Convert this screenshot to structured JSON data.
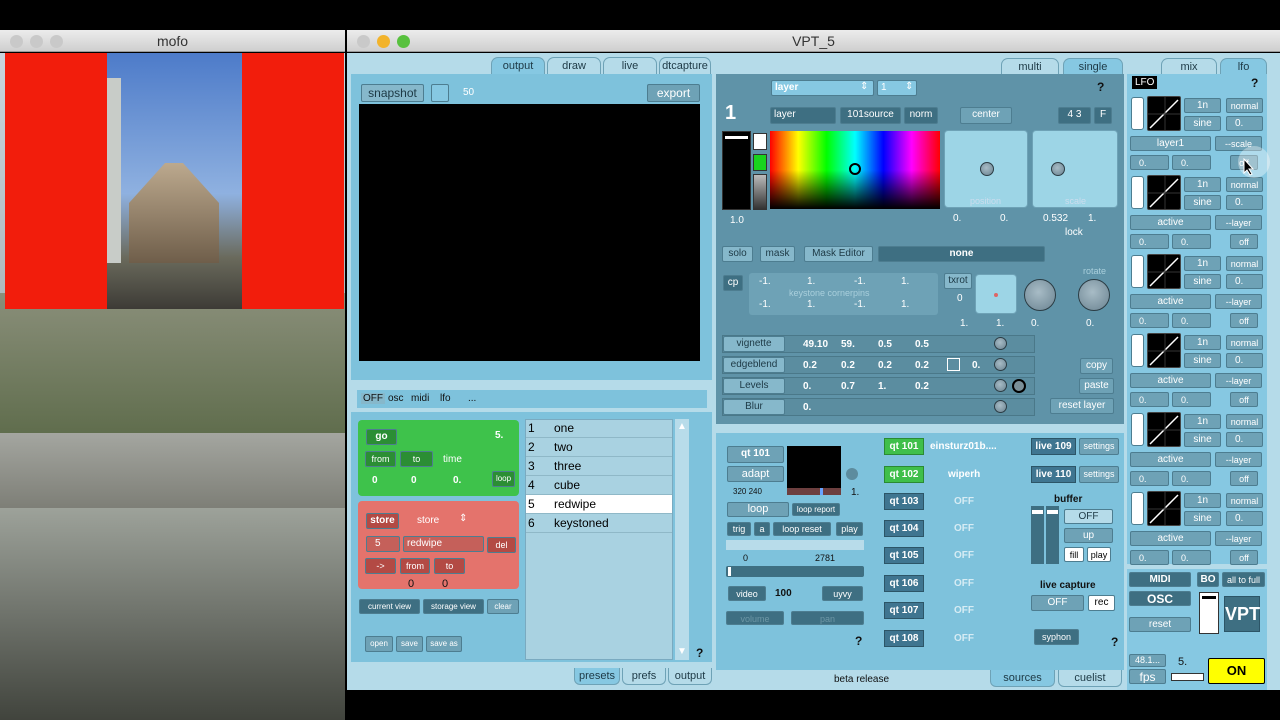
{
  "mofo": {
    "title": "mofo"
  },
  "vpt": {
    "title": "VPT_5"
  },
  "output_tabs": [
    "output",
    "draw",
    "live",
    "dtcapture"
  ],
  "snapshot": {
    "label": "snapshot",
    "value": "50",
    "export": "export"
  },
  "mode_tabs": [
    "multi",
    "single"
  ],
  "mixlfo_tabs": [
    "mix",
    "lfo"
  ],
  "protocols": {
    "off": "OFF",
    "osc": "osc",
    "midi": "midi",
    "lfo": "lfo",
    "more": "..."
  },
  "cue": {
    "go": "go",
    "num": "5.",
    "from": "from",
    "to": "to",
    "time": "time",
    "vals": [
      "0",
      "0",
      "0."
    ],
    "loop": "loop",
    "store": "store",
    "store_select": "store",
    "preset_num": "5",
    "preset_name": "redwipe",
    "del": "del",
    "arrow": "->",
    "from2": "from",
    "to2": "to",
    "vals2": [
      "0",
      "0"
    ],
    "current_view": "current view",
    "storage_view": "storage view",
    "clear": "clear",
    "open": "open",
    "save": "save",
    "save_as": "save as"
  },
  "presets": [
    {
      "n": "1",
      "name": "one"
    },
    {
      "n": "2",
      "name": "two"
    },
    {
      "n": "3",
      "name": "three"
    },
    {
      "n": "4",
      "name": "cube"
    },
    {
      "n": "5",
      "name": "redwipe"
    },
    {
      "n": "6",
      "name": "keystoned"
    }
  ],
  "help": "?",
  "bottom_tabs": [
    "presets",
    "prefs",
    "output"
  ],
  "layer": {
    "select": "layer",
    "index": "1",
    "num": "1",
    "name": "layer",
    "source": "101source",
    "blend": "norm",
    "center": "center",
    "aspect": "4 3",
    "f": "F",
    "opacity": "1.0",
    "position_label": "position",
    "scale_label": "scale",
    "pos": [
      "0.",
      "0."
    ],
    "scl": [
      "0.532",
      "1."
    ],
    "lock": "lock",
    "solo": "solo",
    "mask": "mask",
    "mask_editor": "Mask Editor",
    "mask_name": "none",
    "cp": "cp",
    "keystone_label": "keystone cornerpins",
    "keystone": [
      "-1.",
      "1.",
      "-1.",
      "1.",
      "-1.",
      "1.",
      "-1.",
      "1."
    ],
    "txrot": "txrot",
    "txrot_val": "0",
    "rotate": "rotate",
    "rot_vals": [
      "1.",
      "1.",
      "0.",
      "0."
    ],
    "vignette": "vignette",
    "vignette_vals": [
      "49.10",
      "59.",
      "0.5",
      "0.5"
    ],
    "edgeblend": "edgeblend",
    "edgeblend_vals": [
      "0.2",
      "0.2",
      "0.2",
      "0.2",
      "0."
    ],
    "levels": "Levels",
    "levels_vals": [
      "0.",
      "0.7",
      "1.",
      "0.2"
    ],
    "blur": "Blur",
    "blur_val": "0.",
    "copy": "copy",
    "paste": "paste",
    "reset": "reset layer"
  },
  "source": {
    "qt": "qt 101",
    "adapt": "adapt",
    "res": "320 240",
    "val": "1.",
    "loop": "loop",
    "loop_report": "loop report",
    "trig": "trig",
    "a": "a",
    "loop_reset": "loop reset",
    "play": "play",
    "range": [
      "0",
      "2781"
    ],
    "video": "video",
    "speed": "100",
    "uyvy": "uyvy",
    "volume": "volume",
    "pan": "pan"
  },
  "qt_list": [
    {
      "id": "qt 101",
      "name": "einsturz01b....",
      "green": true
    },
    {
      "id": "qt 102",
      "name": "wiperh",
      "green": true
    },
    {
      "id": "qt 103",
      "name": "OFF"
    },
    {
      "id": "qt 104",
      "name": "OFF"
    },
    {
      "id": "qt 105",
      "name": "OFF"
    },
    {
      "id": "qt 106",
      "name": "OFF"
    },
    {
      "id": "qt 107",
      "name": "OFF"
    },
    {
      "id": "qt 108",
      "name": "OFF"
    }
  ],
  "live": [
    {
      "id": "live 109",
      "s": "settings"
    },
    {
      "id": "live 110",
      "s": "settings"
    }
  ],
  "buffer": {
    "title": "buffer",
    "off": "OFF",
    "up": "up",
    "fill": "fill",
    "play": "play"
  },
  "capture": {
    "title": "live capture",
    "off": "OFF",
    "rec": "rec",
    "syphon": "syphon"
  },
  "footer": {
    "beta": "beta release",
    "sources": "sources",
    "cuelist": "cuelist"
  },
  "lfo": {
    "badge": "LFO",
    "rows": [
      {
        "rate": "1n",
        "mode": "normal",
        "wave": "sine",
        "val": "0.",
        "target": "layer1",
        "sub": "--scale",
        "a": "0.",
        "b": "0.",
        "c": "off"
      },
      {
        "rate": "1n",
        "mode": "normal",
        "wave": "sine",
        "val": "0.",
        "target": "active",
        "sub": "--layer",
        "a": "0.",
        "b": "0.",
        "c": "off"
      },
      {
        "rate": "1n",
        "mode": "normal",
        "wave": "sine",
        "val": "0.",
        "target": "active",
        "sub": "--layer",
        "a": "0.",
        "b": "0.",
        "c": "off"
      },
      {
        "rate": "1n",
        "mode": "normal",
        "wave": "sine",
        "val": "0.",
        "target": "active",
        "sub": "--layer",
        "a": "0.",
        "b": "0.",
        "c": "off"
      },
      {
        "rate": "1n",
        "mode": "normal",
        "wave": "sine",
        "val": "0.",
        "target": "active",
        "sub": "--layer",
        "a": "0.",
        "b": "0.",
        "c": "off"
      },
      {
        "rate": "1n",
        "mode": "normal",
        "wave": "sine",
        "val": "0.",
        "target": "active",
        "sub": "--layer",
        "a": "0.",
        "b": "0.",
        "c": "off"
      }
    ]
  },
  "global": {
    "midi": "MIDI",
    "bo": "BO",
    "all_full": "all to full",
    "osc": "OSC",
    "reset": "reset",
    "logo": "VPT",
    "fps_val": "48.1...",
    "fps": "fps",
    "num": "5.",
    "on": "ON"
  }
}
